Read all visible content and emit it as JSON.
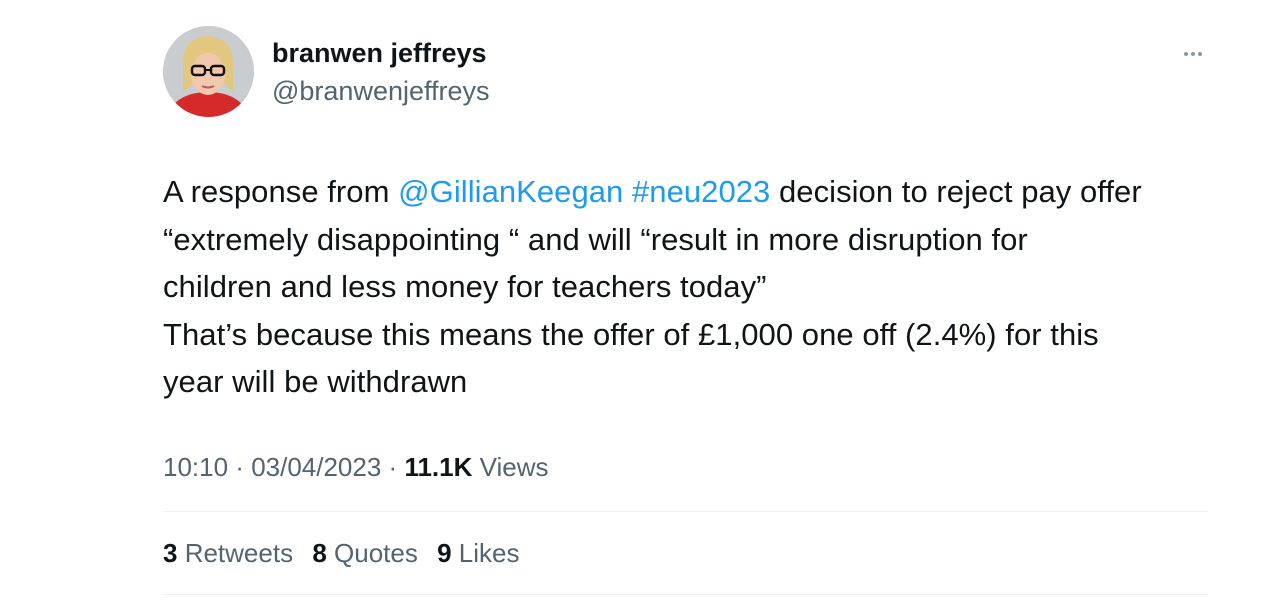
{
  "author": {
    "display_name": "branwen jeffreys",
    "handle": "@branwenjeffreys"
  },
  "tweet": {
    "line1": {
      "prefix": "A response from ",
      "mention": "@GillianKeegan",
      "space": " ",
      "hashtag": "#neu2023",
      "suffix": " decision to reject pay offer"
    },
    "line2": "“extremely disappointing “ and will “result in more disruption for",
    "line3": "children and less money for teachers today”",
    "line4": "That’s because this means the offer of £1,000 one off (2.4%) for this",
    "line5": "year will be withdrawn"
  },
  "meta": {
    "time": "10:10",
    "separator": " · ",
    "date": "03/04/2023",
    "views_count": "11.1K",
    "views_label": " Views"
  },
  "stats": {
    "retweets_count": "3",
    "retweets_label": " Retweets",
    "quotes_count": "8",
    "quotes_label": " Quotes",
    "likes_count": "9",
    "likes_label": " Likes"
  },
  "colors": {
    "link": "#1d9bf0",
    "secondary_text": "#536471",
    "primary_text": "#0f1419"
  },
  "icons": {
    "more": "more-horizontal-icon"
  }
}
